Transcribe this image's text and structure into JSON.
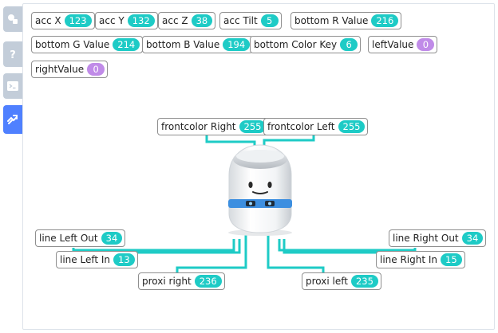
{
  "side_tabs": [
    {
      "icon": "blocks-icon",
      "active": false
    },
    {
      "icon": "help-icon",
      "active": false
    },
    {
      "icon": "terminal-icon",
      "active": false
    },
    {
      "icon": "hardware-link-icon",
      "active": true
    }
  ],
  "chips": {
    "acc_x": {
      "label": "acc X",
      "value": "123"
    },
    "acc_y": {
      "label": "acc Y",
      "value": "132"
    },
    "acc_z": {
      "label": "acc Z",
      "value": "38"
    },
    "acc_tilt": {
      "label": "acc Tilt",
      "value": "5"
    },
    "bottom_r": {
      "label": "bottom R Value",
      "value": "216"
    },
    "bottom_g": {
      "label": "bottom G Value",
      "value": "214"
    },
    "bottom_b": {
      "label": "bottom B Value",
      "value": "194"
    },
    "bottom_color_key": {
      "label": "bottom Color Key",
      "value": "6"
    },
    "left_value": {
      "label": "leftValue",
      "value": "0"
    },
    "right_value": {
      "label": "rightValue",
      "value": "0"
    },
    "front_right": {
      "label": "frontcolor Right",
      "value": "255"
    },
    "front_left": {
      "label": "frontcolor Left",
      "value": "255"
    },
    "line_left_out": {
      "label": "line Left Out",
      "value": "34"
    },
    "line_left_in": {
      "label": "line Left In",
      "value": "13"
    },
    "proxi_right": {
      "label": "proxi right",
      "value": "236"
    },
    "line_right_out": {
      "label": "line Right Out",
      "value": "34"
    },
    "line_right_in": {
      "label": "line Right In",
      "value": "15"
    },
    "proxi_left": {
      "label": "proxi left",
      "value": "235"
    }
  },
  "colors": {
    "value_badge": "#1ecbc6",
    "value_badge_alt": "#c08be8",
    "wire": "#1ecbc6",
    "active_tab": "#4f80ff",
    "inactive_tab": "#c3cdd9"
  }
}
